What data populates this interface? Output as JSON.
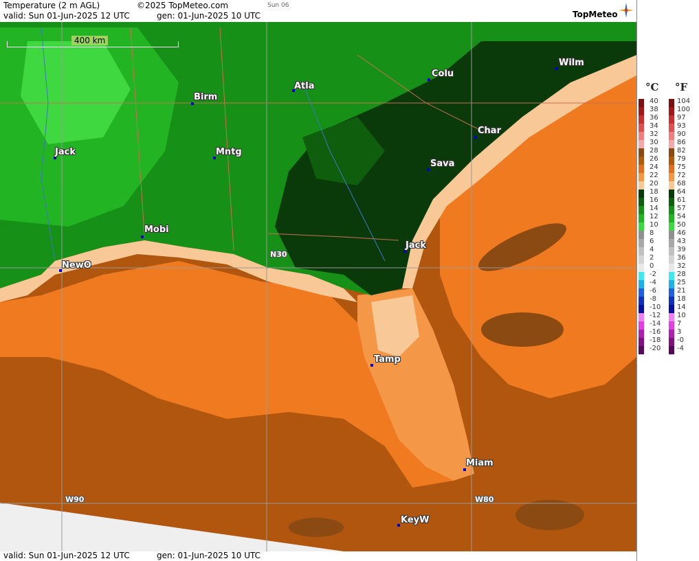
{
  "header": {
    "title": "Temperature (2 m AGL)",
    "copyright": "©2025 TopMeteo.com",
    "day": "Sun 06",
    "valid": "valid:  Sun  01-Jun-2025  12 UTC",
    "gen": "gen: 01-Jun-2025 10 UTC",
    "logo": "TopMeteo"
  },
  "footer": {
    "valid": "valid:  Sun  01-Jun-2025  12 UTC",
    "gen": "gen: 01-Jun-2025 10 UTC"
  },
  "map": {
    "scale_label": "400 km",
    "grid_labels": {
      "lat": "N30",
      "lon_w90": "W90",
      "lon_w80": "W80"
    },
    "cities": [
      {
        "name": "Jack"
      },
      {
        "name": "Birm"
      },
      {
        "name": "Atla"
      },
      {
        "name": "Colu"
      },
      {
        "name": "Wilm"
      },
      {
        "name": "Char"
      },
      {
        "name": "Sava"
      },
      {
        "name": "Mntg"
      },
      {
        "name": "Mobi"
      },
      {
        "name": "NewO"
      },
      {
        "name": "Jack"
      },
      {
        "name": "Tamp"
      },
      {
        "name": "Miam"
      },
      {
        "name": "KeyW"
      }
    ]
  },
  "legend": {
    "unit_c": "°C",
    "unit_f": "°F",
    "celsius": [
      "40",
      "38",
      "36",
      "34",
      "32",
      "30",
      "28",
      "26",
      "24",
      "22",
      "20",
      "18",
      "16",
      "14",
      "12",
      "10",
      "8",
      "6",
      "4",
      "2",
      "0",
      "-2",
      "-4",
      "-6",
      "-8",
      "-10",
      "-12",
      "-14",
      "-16",
      "-18",
      "-20"
    ],
    "fahrenheit": [
      "104",
      "100",
      "97",
      "93",
      "90",
      "86",
      "82",
      "79",
      "75",
      "72",
      "68",
      "64",
      "61",
      "57",
      "54",
      "50",
      "46",
      "43",
      "39",
      "36",
      "32",
      "28",
      "25",
      "21",
      "18",
      "14",
      "10",
      "7",
      "3",
      "-0",
      "-4"
    ],
    "colors": [
      "#7a1010",
      "#a01818",
      "#c83030",
      "#e05050",
      "#f08080",
      "#f4a8a8",
      "#8b4a12",
      "#b05a10",
      "#e07020",
      "#f49848",
      "#f8c896",
      "#0a3a0a",
      "#0e5e0e",
      "#169016",
      "#22b422",
      "#40d840",
      "#909090",
      "#a8a8a8",
      "#c0c0c0",
      "#d4d4d4",
      "#e8e8e8",
      "#40e8f0",
      "#20b0e8",
      "#2060e0",
      "#1030c0",
      "#0810a0",
      "#f080f0",
      "#e040e0",
      "#b020b0",
      "#801080",
      "#580858"
    ]
  }
}
